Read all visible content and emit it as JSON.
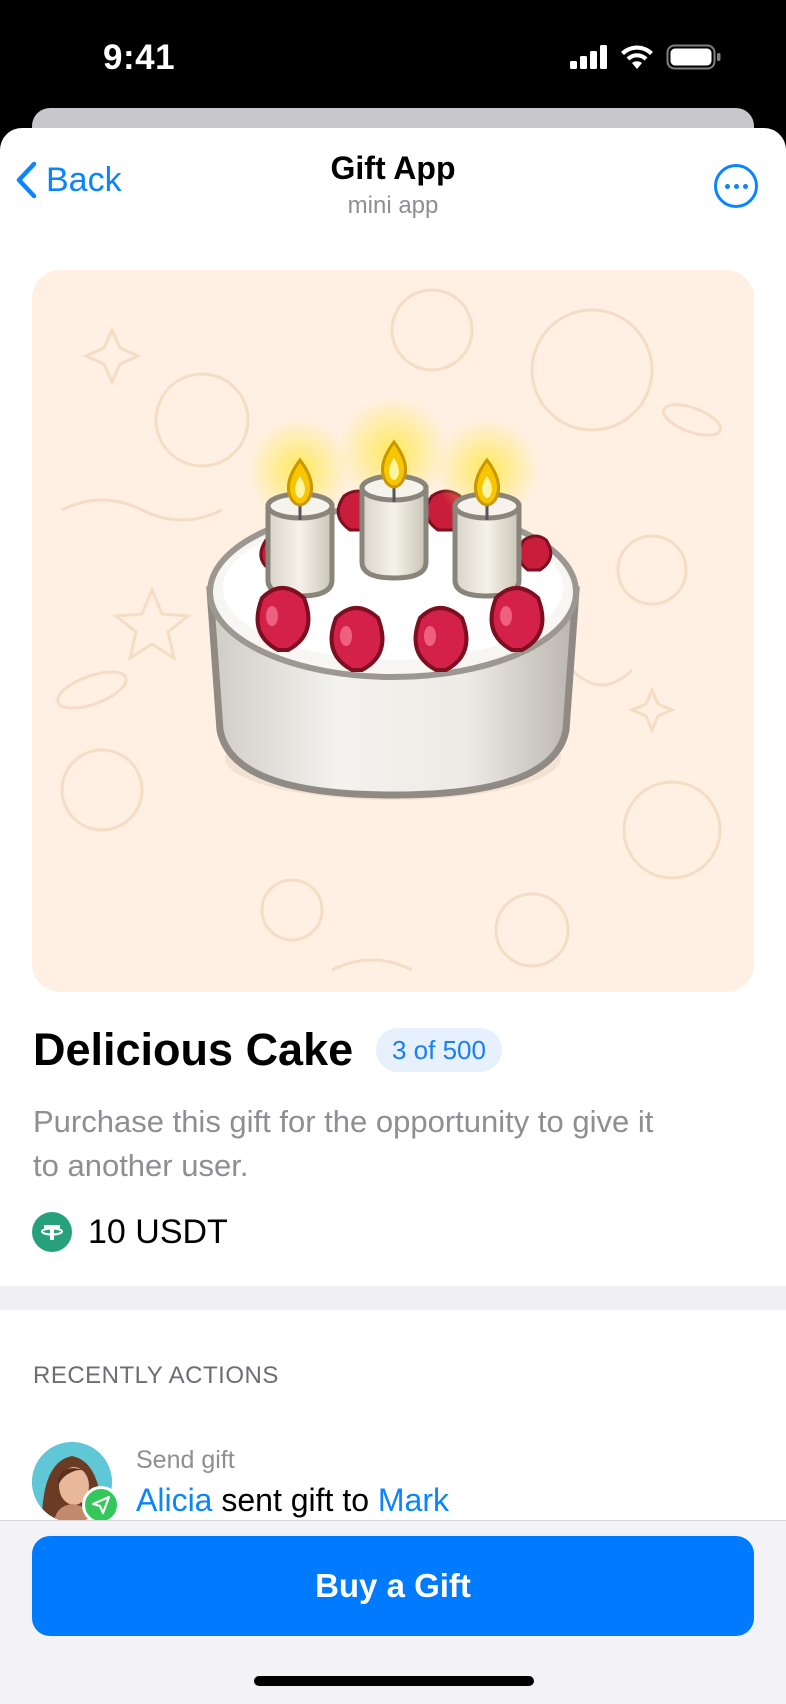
{
  "status_bar": {
    "time": "9:41"
  },
  "nav": {
    "back_label": "Back",
    "title": "Gift App",
    "subtitle": "mini app"
  },
  "gift": {
    "title": "Delicious Cake",
    "count_badge": "3 of 500",
    "description": "Purchase this gift for the opportunity to give it to another user.",
    "price": "10 USDT",
    "currency_icon": "usdt-icon"
  },
  "recent": {
    "header": "RECENTLY ACTIONS",
    "items": [
      {
        "type": "Send gift",
        "sender": "Alicia",
        "middle": " sent gift to ",
        "recipient": "Mark"
      }
    ]
  },
  "buy_button": {
    "label": "Buy a Gift"
  },
  "colors": {
    "accent": "#007aff",
    "hero_bg": "#fff0e3",
    "usdt": "#26a17b",
    "badge_bg": "#e6f1fd"
  }
}
